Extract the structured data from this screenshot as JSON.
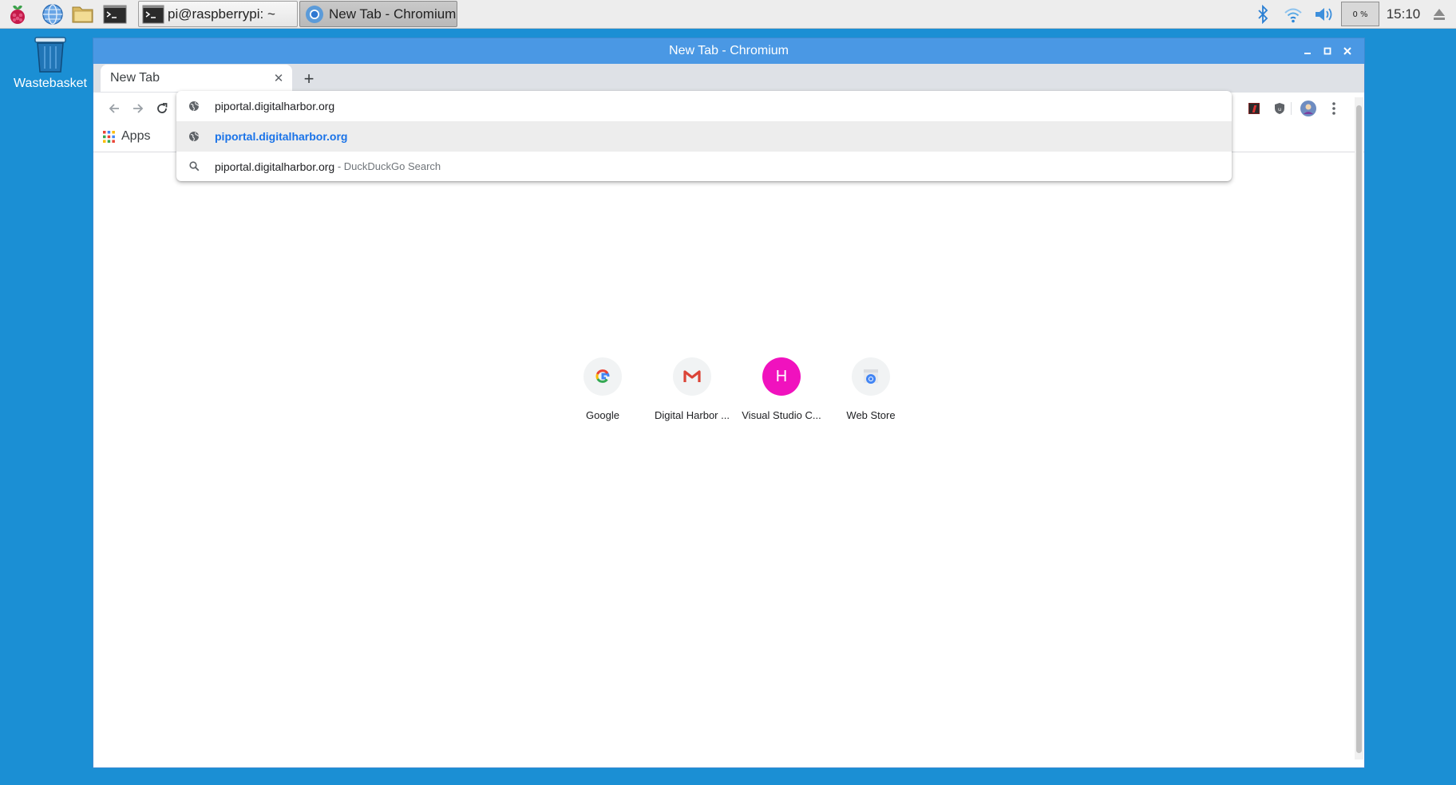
{
  "taskbar": {
    "tasks": [
      {
        "label": "pi@raspberrypi: ~",
        "icon": "terminal-icon"
      },
      {
        "label": "New Tab - Chromium",
        "icon": "chromium-icon"
      }
    ],
    "battery_label": "0 %",
    "clock": "15:10"
  },
  "desktop": {
    "icons": [
      {
        "label": "Wastebasket",
        "icon": "trash-icon"
      }
    ]
  },
  "window": {
    "title": "New Tab - Chromium",
    "tab": {
      "label": "New Tab"
    },
    "bookmarks": {
      "apps_label": "Apps"
    },
    "omnibox": {
      "input_value": "piportal.digitalharbor.org",
      "suggestions": [
        {
          "text": "piportal.digitalharbor.org",
          "icon": "globe-icon"
        },
        {
          "text": "piportal.digitalharbor.org",
          "desc": " - DuckDuckGo Search",
          "icon": "search-icon"
        }
      ]
    },
    "shortcuts": [
      {
        "label": "Google",
        "icon": "google-icon"
      },
      {
        "label": "Digital Harbor ...",
        "icon": "gmail-icon"
      },
      {
        "label": "Visual Studio C...",
        "icon": "letter-h-icon",
        "letter": "H"
      },
      {
        "label": "Web Store",
        "icon": "webstore-icon"
      }
    ]
  },
  "colors": {
    "desktop_bg": "#1b8fd4",
    "titlebar": "#4a98e4",
    "link": "#1a73e8",
    "avatar_h": "#f012be"
  }
}
